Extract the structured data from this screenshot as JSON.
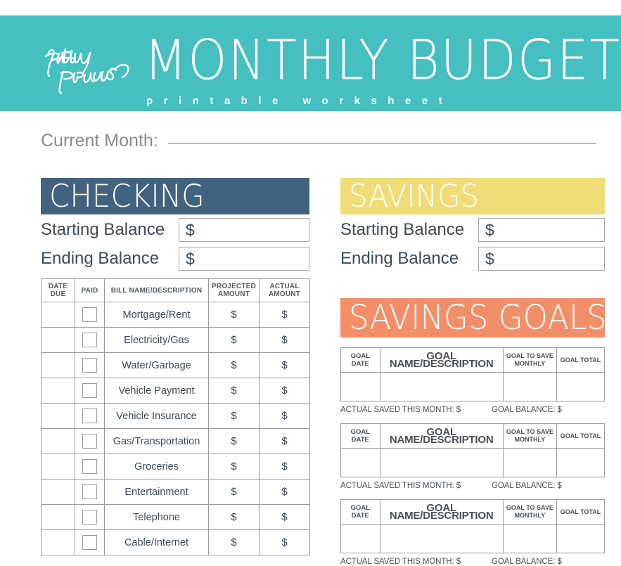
{
  "banner": {
    "logo_script": "pretty presets",
    "title": "MONTHLY BUDGET",
    "subtitle": "printable worksheet",
    "background_color": "#45bfc0"
  },
  "month": {
    "label": "Current Month:",
    "value": ""
  },
  "checking": {
    "heading": "CHECKING",
    "heading_color": "#42637f",
    "starting_balance_label": "Starting Balance",
    "starting_balance_value": "$",
    "ending_balance_label": "Ending Balance",
    "ending_balance_value": "$",
    "table": {
      "headers": [
        "DATE\nDUE",
        "PAID",
        "BILL NAME/DESCRIPTION",
        "PROJECTED\nAMOUNT",
        "ACTUAL\nAMOUNT"
      ],
      "header_date_due_line1": "DATE",
      "header_date_due_line2": "DUE",
      "header_paid": "PAID",
      "header_bill_name": "BILL NAME/DESCRIPTION",
      "header_projected_line1": "PROJECTED",
      "header_projected_line2": "AMOUNT",
      "header_actual_line1": "ACTUAL",
      "header_actual_line2": "AMOUNT",
      "dollar_sign": "$",
      "rows": [
        {
          "date_due": "",
          "paid": false,
          "name": "Mortgage/Rent",
          "projected": "$",
          "actual": "$"
        },
        {
          "date_due": "",
          "paid": false,
          "name": "Electricity/Gas",
          "projected": "$",
          "actual": "$"
        },
        {
          "date_due": "",
          "paid": false,
          "name": "Water/Garbage",
          "projected": "$",
          "actual": "$"
        },
        {
          "date_due": "",
          "paid": false,
          "name": "Vehicle Payment",
          "projected": "$",
          "actual": "$"
        },
        {
          "date_due": "",
          "paid": false,
          "name": "Vehicle Insurance",
          "projected": "$",
          "actual": "$"
        },
        {
          "date_due": "",
          "paid": false,
          "name": "Gas/Transportation",
          "projected": "$",
          "actual": "$"
        },
        {
          "date_due": "",
          "paid": false,
          "name": "Groceries",
          "projected": "$",
          "actual": "$"
        },
        {
          "date_due": "",
          "paid": false,
          "name": "Entertainment",
          "projected": "$",
          "actual": "$"
        },
        {
          "date_due": "",
          "paid": false,
          "name": "Telephone",
          "projected": "$",
          "actual": "$"
        },
        {
          "date_due": "",
          "paid": false,
          "name": "Cable/Internet",
          "projected": "$",
          "actual": "$"
        }
      ]
    }
  },
  "savings": {
    "heading": "SAVINGS",
    "heading_color": "#f0dd77",
    "starting_balance_label": "Starting Balance",
    "starting_balance_value": "$",
    "ending_balance_label": "Ending Balance",
    "ending_balance_value": "$"
  },
  "savings_goals": {
    "heading": "SAVINGS GOALS",
    "heading_color": "#f28f68",
    "table": {
      "header_goal_date_line1": "GOAL",
      "header_goal_date_line2": "DATE",
      "header_goal_name": "GOAL NAME/DESCRIPTION",
      "header_monthly_line1": "GOAL TO SAVE",
      "header_monthly_line2": "MONTHLY",
      "header_goal_total": "GOAL TOTAL"
    },
    "footer": {
      "actual_saved_label": "ACTUAL SAVED THIS MONTH: $",
      "goal_balance_label": "GOAL BALANCE: $"
    },
    "blocks": [
      {
        "goal_date": "",
        "goal_name": "",
        "goal_monthly": "",
        "goal_total": ""
      },
      {
        "goal_date": "",
        "goal_name": "",
        "goal_monthly": "",
        "goal_total": ""
      },
      {
        "goal_date": "",
        "goal_name": "",
        "goal_monthly": "",
        "goal_total": ""
      }
    ]
  }
}
